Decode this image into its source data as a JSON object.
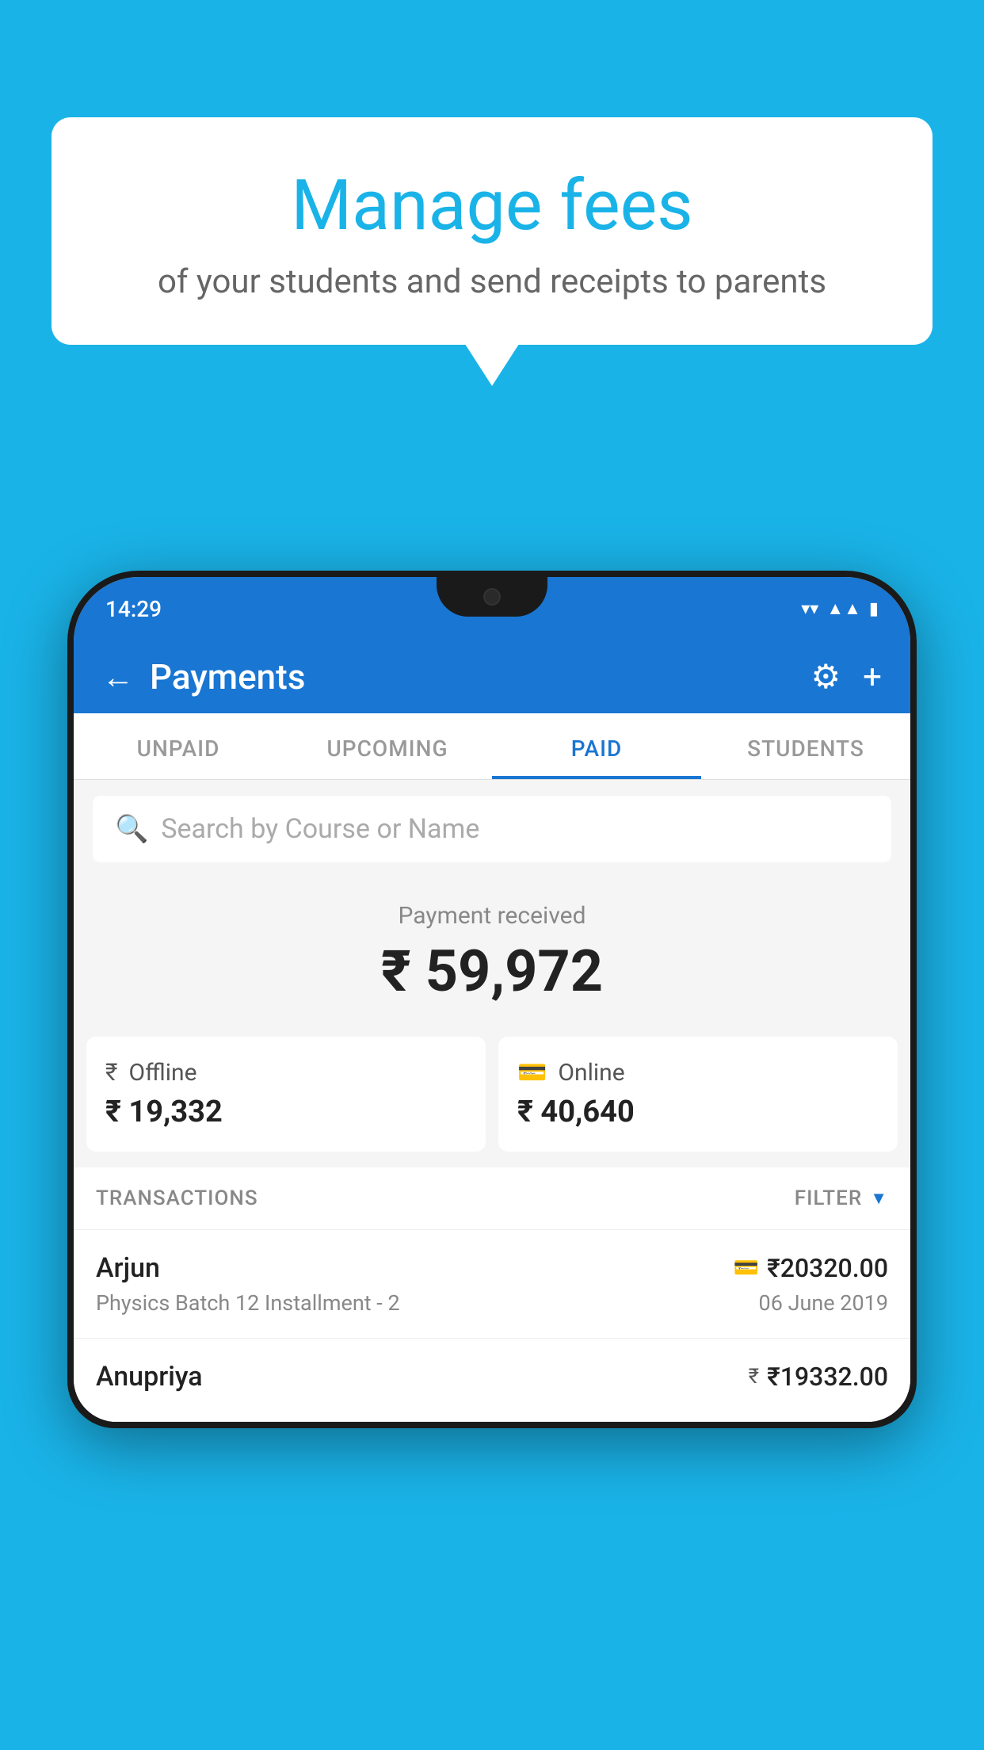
{
  "background_color": "#1ab3e8",
  "speech_bubble": {
    "title": "Manage fees",
    "subtitle": "of your students and send receipts to parents"
  },
  "status_bar": {
    "time": "14:29",
    "icons": [
      "wifi",
      "signal",
      "battery"
    ]
  },
  "header": {
    "title": "Payments",
    "back_label": "←",
    "settings_label": "⚙",
    "add_label": "+"
  },
  "tabs": [
    {
      "label": "UNPAID",
      "active": false
    },
    {
      "label": "UPCOMING",
      "active": false
    },
    {
      "label": "PAID",
      "active": true
    },
    {
      "label": "STUDENTS",
      "active": false
    }
  ],
  "search": {
    "placeholder": "Search by Course or Name"
  },
  "payment_received": {
    "label": "Payment received",
    "amount": "₹ 59,972",
    "offline": {
      "type": "Offline",
      "amount": "₹ 19,332"
    },
    "online": {
      "type": "Online",
      "amount": "₹ 40,640"
    }
  },
  "transactions": {
    "label": "TRANSACTIONS",
    "filter_label": "FILTER",
    "rows": [
      {
        "name": "Arjun",
        "course": "Physics Batch 12 Installment - 2",
        "amount": "₹20320.00",
        "date": "06 June 2019",
        "payment_type": "card"
      },
      {
        "name": "Anupriya",
        "course": "",
        "amount": "₹19332.00",
        "date": "",
        "payment_type": "cash"
      }
    ]
  }
}
